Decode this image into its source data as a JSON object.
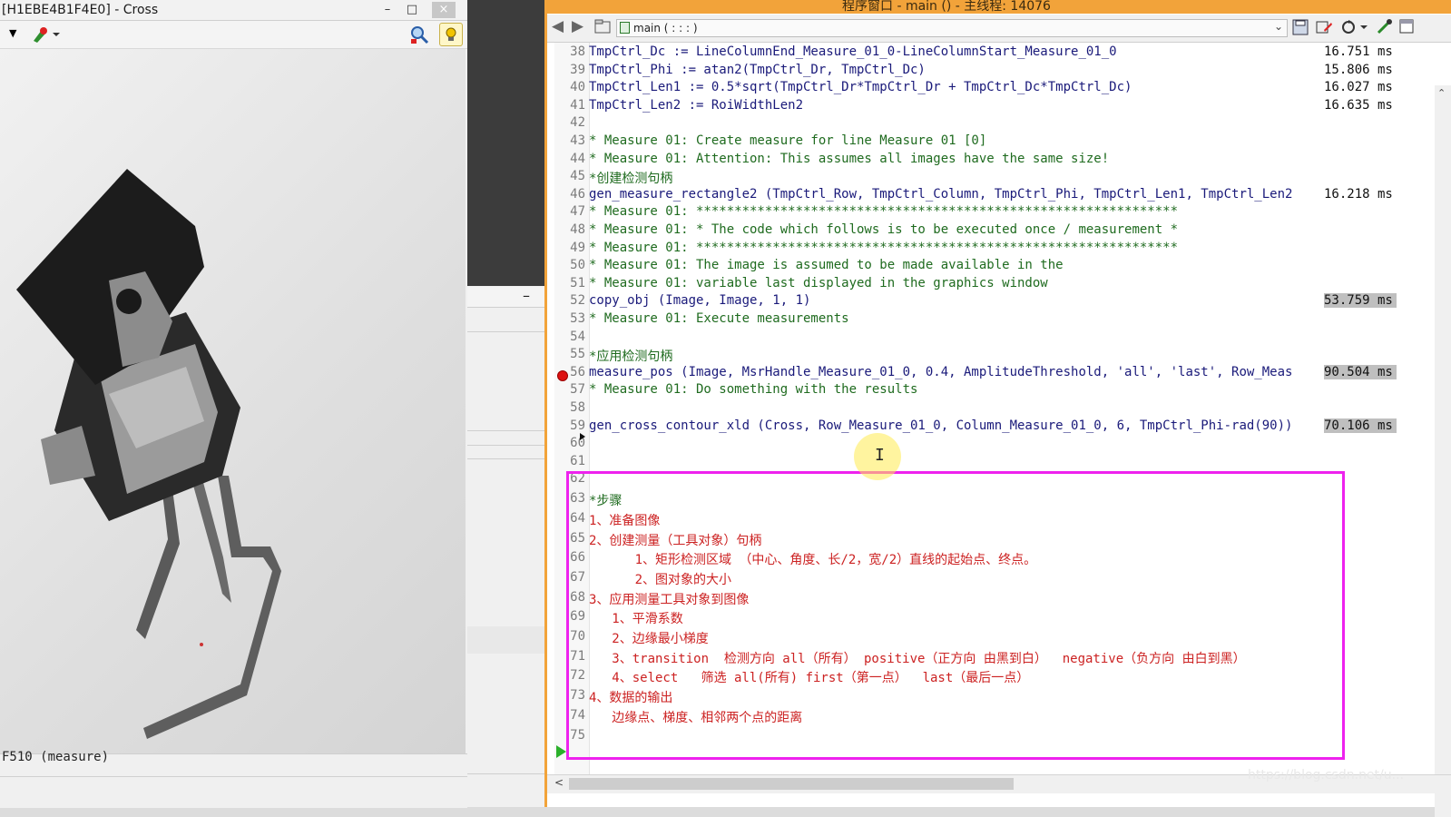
{
  "graphics_window": {
    "title": "[H1EBE4B1F4E0] - Cross",
    "status": "F510 (measure)",
    "controls": {
      "minimize": "–",
      "maximize": "□",
      "close": "×"
    },
    "toolbar_icons": [
      "dropdown-arrow-icon",
      "drawing-tool-icon",
      "zoom-icon",
      "lightbulb-icon"
    ]
  },
  "middle_panel": {
    "collapse": "–"
  },
  "program_window": {
    "title": "程序窗口 - main () - 主线程: 14076",
    "procedure_label": "main ( : : : )",
    "lines": [
      {
        "num": "38",
        "code": "TmpCtrl_Dc := LineColumnEnd_Measure_01_0-LineColumnStart_Measure_01_0",
        "kind": "code",
        "time": "16.751 ms"
      },
      {
        "num": "39",
        "code": "TmpCtrl_Phi := atan2(TmpCtrl_Dr, TmpCtrl_Dc)",
        "kind": "code",
        "time": "15.806 ms"
      },
      {
        "num": "40",
        "code": "TmpCtrl_Len1 := 0.5*sqrt(TmpCtrl_Dr*TmpCtrl_Dr + TmpCtrl_Dc*TmpCtrl_Dc)",
        "kind": "code",
        "time": "16.027 ms"
      },
      {
        "num": "41",
        "code": "TmpCtrl_Len2 := RoiWidthLen2",
        "kind": "code",
        "time": "16.635 ms"
      },
      {
        "num": "42",
        "code": "",
        "kind": "code",
        "time": ""
      },
      {
        "num": "43",
        "code": "* Measure 01: Create measure for line Measure 01 [0]",
        "kind": "comment",
        "time": ""
      },
      {
        "num": "44",
        "code": "* Measure 01: Attention: This assumes all images have the same size!",
        "kind": "comment",
        "time": ""
      },
      {
        "num": "45",
        "code": "*创建检测句柄",
        "kind": "comment",
        "time": ""
      },
      {
        "num": "46",
        "code": "gen_measure_rectangle2 (TmpCtrl_Row, TmpCtrl_Column, TmpCtrl_Phi, TmpCtrl_Len1, TmpCtrl_Len2",
        "kind": "code",
        "time": "16.218 ms"
      },
      {
        "num": "47",
        "code": "* Measure 01: ***************************************************************",
        "kind": "comment",
        "time": ""
      },
      {
        "num": "48",
        "code": "* Measure 01: * The code which follows is to be executed once / measurement *",
        "kind": "comment",
        "time": ""
      },
      {
        "num": "49",
        "code": "* Measure 01: ***************************************************************",
        "kind": "comment",
        "time": ""
      },
      {
        "num": "50",
        "code": "* Measure 01: The image is assumed to be made available in the",
        "kind": "comment",
        "time": ""
      },
      {
        "num": "51",
        "code": "* Measure 01: variable last displayed in the graphics window",
        "kind": "comment",
        "time": ""
      },
      {
        "num": "52",
        "code": "copy_obj (Image, Image, 1, 1)",
        "kind": "code",
        "time": "53.759 ms"
      },
      {
        "num": "53",
        "code": "* Measure 01: Execute measurements",
        "kind": "comment",
        "time": ""
      },
      {
        "num": "54",
        "code": "",
        "kind": "code",
        "time": ""
      },
      {
        "num": "55",
        "code": "*应用检测句柄",
        "kind": "comment",
        "time": ""
      },
      {
        "num": "56",
        "code": "measure_pos (Image, MsrHandle_Measure_01_0, 0.4, AmplitudeThreshold, 'all', 'last', Row_Meas",
        "kind": "code",
        "time": "90.504 ms"
      },
      {
        "num": "57",
        "code": "* Measure 01: Do something with the results",
        "kind": "comment",
        "time": ""
      },
      {
        "num": "58",
        "code": "",
        "kind": "code",
        "time": ""
      },
      {
        "num": "59",
        "code": "gen_cross_contour_xld (Cross, Row_Measure_01_0, Column_Measure_01_0, 6, TmpCtrl_Phi-rad(90))",
        "kind": "code",
        "time": "70.106 ms"
      },
      {
        "num": "60",
        "code": "",
        "kind": "code",
        "time": ""
      },
      {
        "num": "61",
        "code": "",
        "kind": "code",
        "time": ""
      },
      {
        "num": "62",
        "code": "",
        "kind": "note",
        "time": ""
      },
      {
        "num": "63",
        "code": "*步骤",
        "kind": "comment",
        "time": ""
      },
      {
        "num": "64",
        "code": "1、准备图像",
        "kind": "note",
        "time": ""
      },
      {
        "num": "65",
        "code": "2、创建测量（工具对象）句柄",
        "kind": "note",
        "time": ""
      },
      {
        "num": "66",
        "code": "      1、矩形检测区域 （中心、角度、长/2，宽/2）直线的起始点、终点。",
        "kind": "note",
        "time": ""
      },
      {
        "num": "67",
        "code": "      2、图对象的大小",
        "kind": "note",
        "time": ""
      },
      {
        "num": "68",
        "code": "3、应用测量工具对象到图像",
        "kind": "note",
        "time": ""
      },
      {
        "num": "69",
        "code": "   1、平滑系数",
        "kind": "note",
        "time": ""
      },
      {
        "num": "70",
        "code": "   2、边缘最小梯度",
        "kind": "note",
        "time": ""
      },
      {
        "num": "71",
        "code": "   3、transition  检测方向 all（所有） positive（正方向 由黑到白）  negative（负方向 由白到黑）",
        "kind": "note",
        "time": ""
      },
      {
        "num": "72",
        "code": "   4、select   筛选 all(所有) first（第一点）  last（最后一点）",
        "kind": "note",
        "time": ""
      },
      {
        "num": "73",
        "code": "4、数据的输出",
        "kind": "note",
        "time": ""
      },
      {
        "num": "74",
        "code": "   边缘点、梯度、相邻两个点的距离",
        "kind": "note",
        "time": ""
      },
      {
        "num": "75",
        "code": "",
        "kind": "note",
        "time": ""
      }
    ],
    "watermark": "https://blog.csdn.net/u..."
  }
}
